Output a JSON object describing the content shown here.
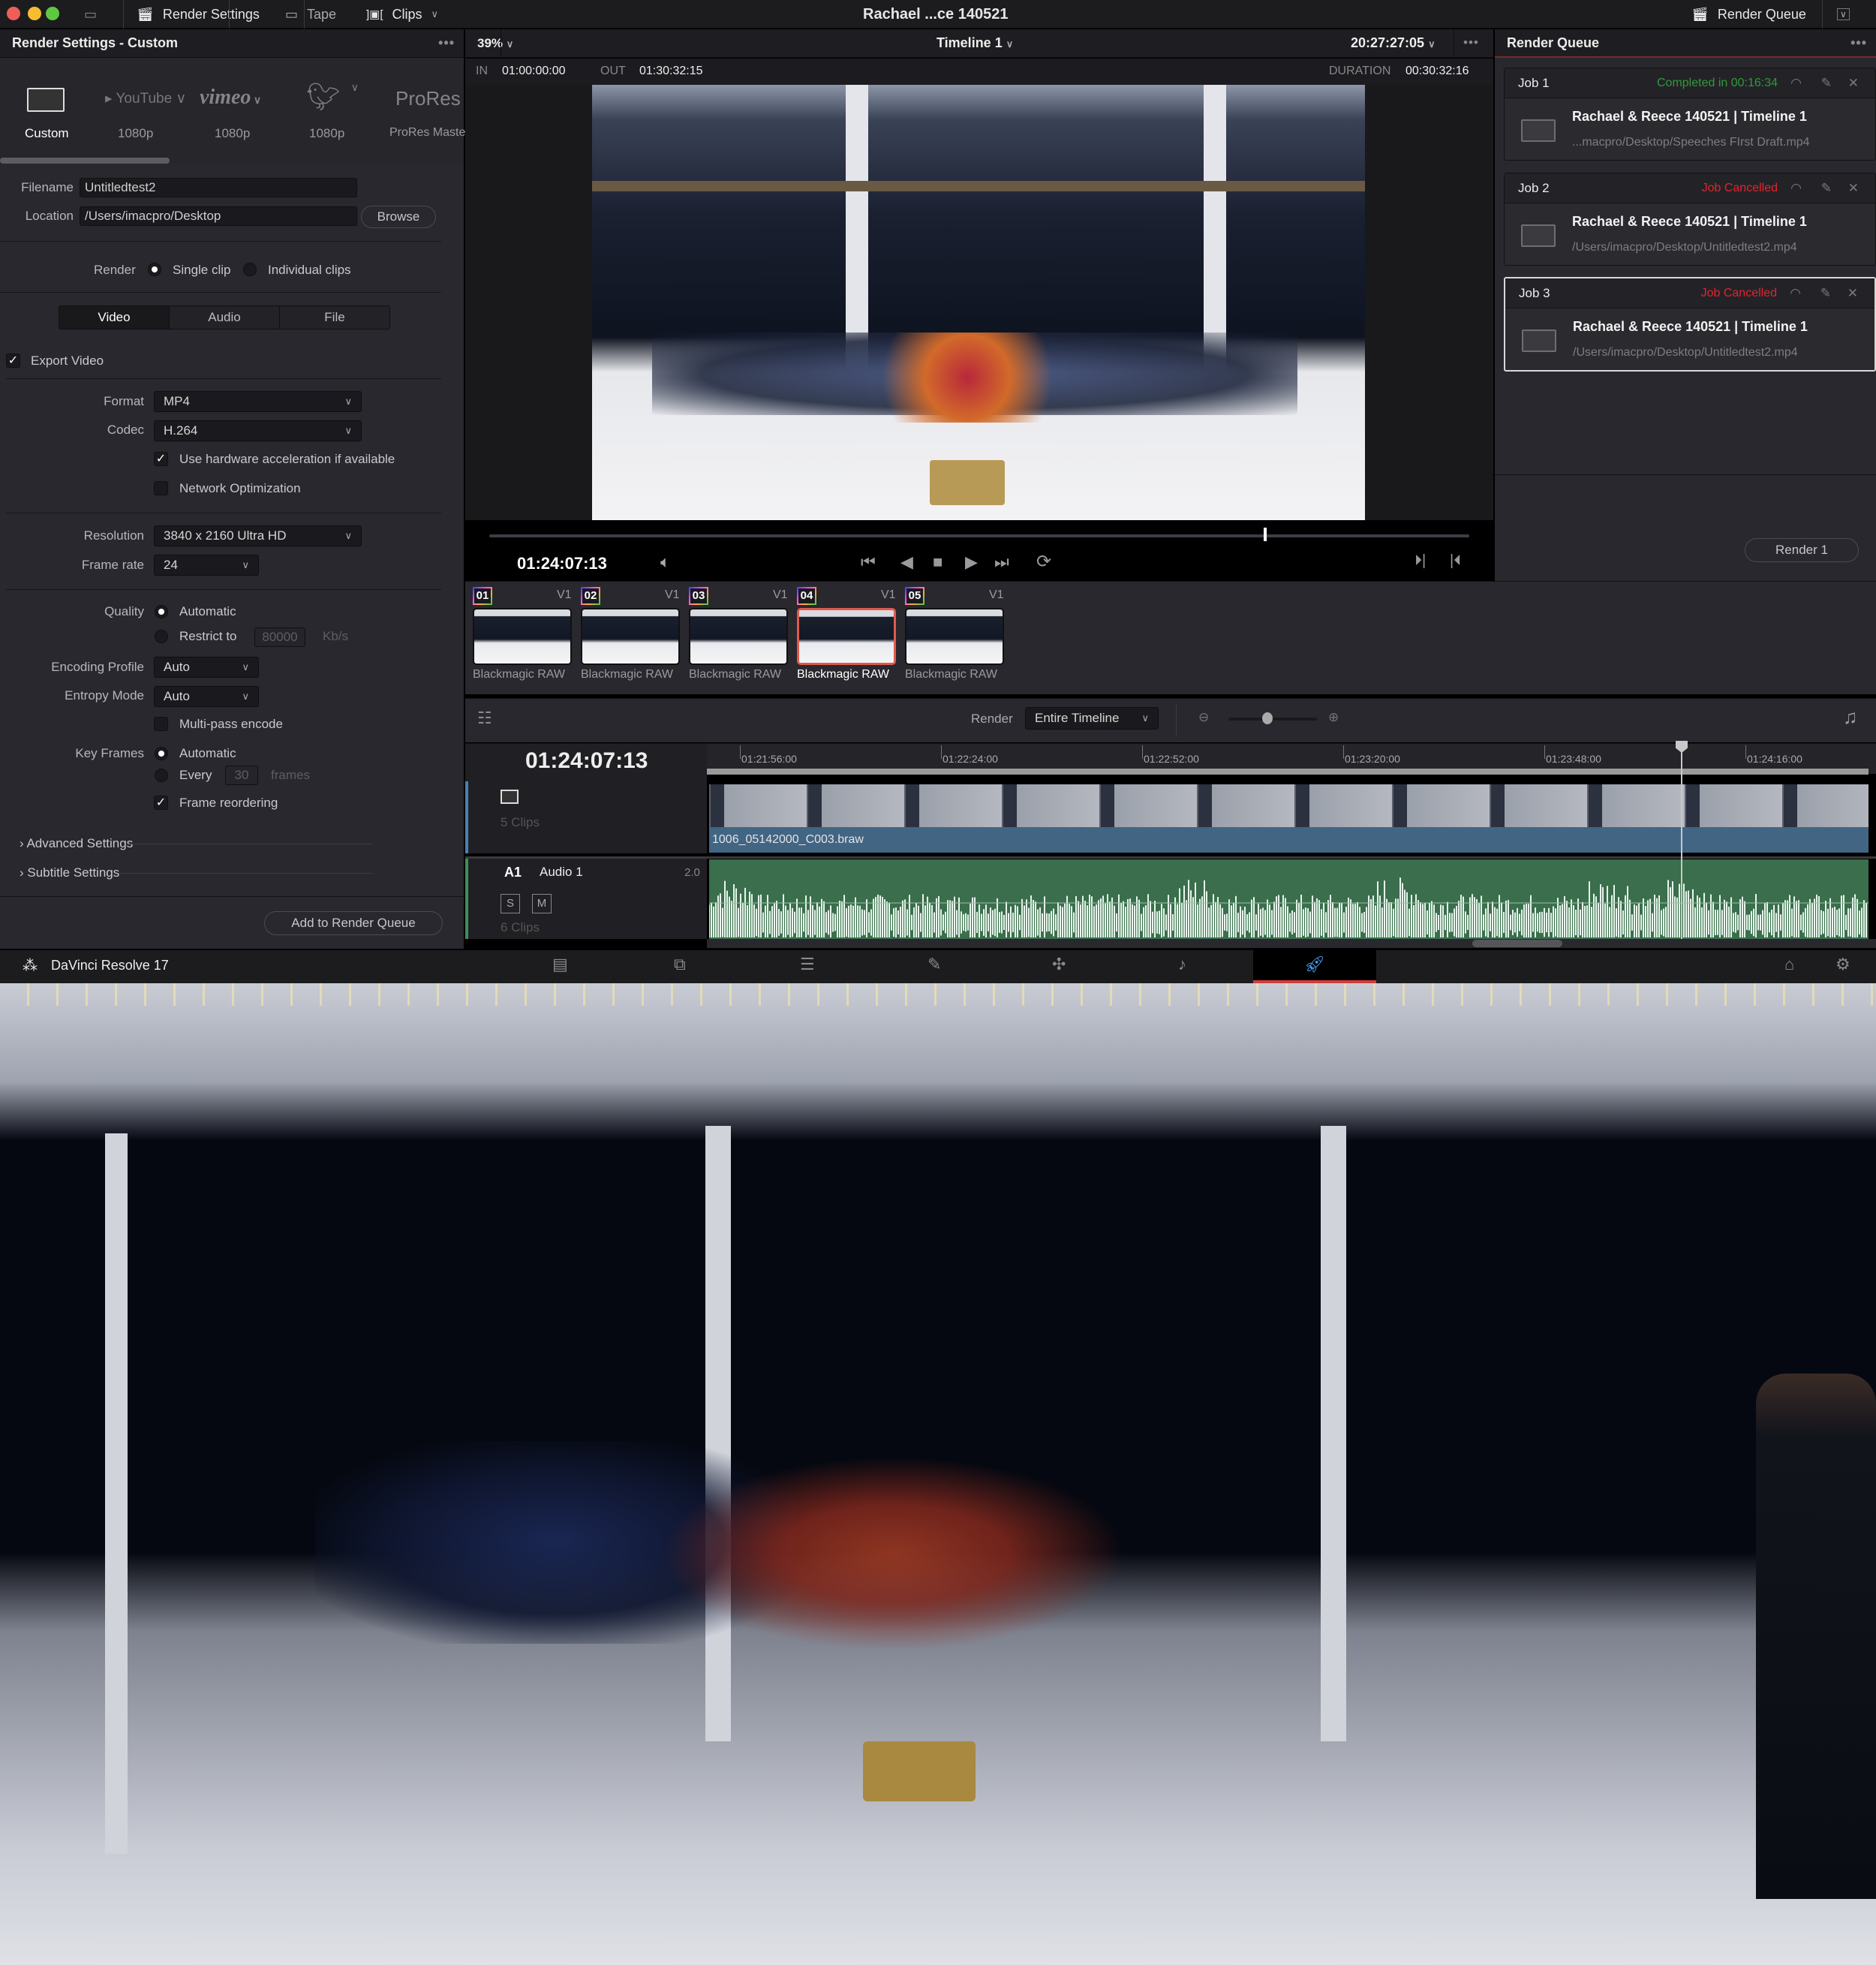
{
  "window": {
    "title": "Rachael ...ce 140521",
    "toolbar": {
      "render_settings": "Render Settings",
      "tape": "Tape",
      "clips": "Clips",
      "render_queue": "Render Queue"
    }
  },
  "render_settings": {
    "header": "Render Settings - Custom",
    "presets": [
      {
        "name": "Custom",
        "label": "Custom",
        "icon": "film-icon"
      },
      {
        "name": "YouTube",
        "label": "1080p",
        "icon": "youtube-logo"
      },
      {
        "name": "vimeo",
        "label": "1080p",
        "icon": "vimeo-logo"
      },
      {
        "name": "Twitter",
        "label": "1080p",
        "icon": "twitter-bird-icon"
      },
      {
        "name": "ProRes",
        "label": "ProRes Master",
        "icon": "prores-logo"
      }
    ],
    "filename_label": "Filename",
    "filename_value": "Untitledtest2",
    "location_label": "Location",
    "location_value": "/Users/imacpro/Desktop",
    "browse": "Browse",
    "render_label": "Render",
    "single_clip": "Single clip",
    "individual_clips": "Individual clips",
    "tabs": [
      "Video",
      "Audio",
      "File"
    ],
    "active_tab": "Video",
    "export_video": "Export Video",
    "format_label": "Format",
    "format_value": "MP4",
    "codec_label": "Codec",
    "codec_value": "H.264",
    "hw_accel": "Use hardware acceleration if available",
    "network_opt": "Network Optimization",
    "resolution_label": "Resolution",
    "resolution_value": "3840 x 2160 Ultra HD",
    "framerate_label": "Frame rate",
    "framerate_value": "24",
    "quality_label": "Quality",
    "quality_auto": "Automatic",
    "quality_restrict": "Restrict to",
    "quality_restrict_value": "80000",
    "quality_unit": "Kb/s",
    "encoding_profile_label": "Encoding Profile",
    "encoding_profile_value": "Auto",
    "entropy_label": "Entropy Mode",
    "entropy_value": "Auto",
    "multipass": "Multi-pass encode",
    "keyframes_label": "Key Frames",
    "keyframes_auto": "Automatic",
    "keyframes_every": "Every",
    "keyframes_every_value": "30",
    "keyframes_unit": "frames",
    "frame_reorder": "Frame reordering",
    "advanced": "Advanced Settings",
    "subtitle": "Subtitle Settings",
    "add_to_queue": "Add to Render Queue"
  },
  "viewer": {
    "zoom": "39%",
    "timeline_name": "Timeline 1",
    "timecode_top": "20:27:27:05",
    "in_label": "IN",
    "in_value": "01:00:00:00",
    "out_label": "OUT",
    "out_value": "01:30:32:15",
    "duration_label": "DURATION",
    "duration_value": "00:30:32:16",
    "current_tc": "01:24:07:13",
    "scrub_position": 0.79
  },
  "clips": [
    {
      "num": "01",
      "track": "V1",
      "name": "Blackmagic RAW"
    },
    {
      "num": "02",
      "track": "V1",
      "name": "Blackmagic RAW"
    },
    {
      "num": "03",
      "track": "V1",
      "name": "Blackmagic RAW"
    },
    {
      "num": "04",
      "track": "V1",
      "name": "Blackmagic RAW",
      "selected": true
    },
    {
      "num": "05",
      "track": "V1",
      "name": "Blackmagic RAW"
    }
  ],
  "timeline": {
    "render_label": "Render",
    "render_value": "Entire Timeline",
    "timecode": "01:24:07:13",
    "ruler": [
      "01:21:56:00",
      "01:22:24:00",
      "01:22:52:00",
      "01:23:20:00",
      "01:23:48:00",
      "01:24:16:00"
    ],
    "video_track_clips": "5 Clips",
    "video_clip_name": "1006_05142000_C003.braw",
    "audio_track_id": "A1",
    "audio_track_name": "Audio 1",
    "audio_channels": "2.0",
    "solo": "S",
    "mute": "M",
    "audio_track_clips": "6 Clips"
  },
  "render_queue": {
    "header": "Render Queue",
    "jobs": [
      {
        "id": "Job 1",
        "status": "Completed in 00:16:34",
        "status_color": "#2f9a3a",
        "title": "Rachael & Reece 140521 | Timeline 1",
        "path": "...macpro/Desktop/Speeches FIrst Draft.mp4"
      },
      {
        "id": "Job 2",
        "status": "Job Cancelled",
        "status_color": "#e0242f",
        "title": "Rachael & Reece 140521 | Timeline 1",
        "path": "/Users/imacpro/Desktop/Untitledtest2.mp4"
      },
      {
        "id": "Job 3",
        "status": "Job Cancelled",
        "status_color": "#e0242f",
        "title": "Rachael & Reece 140521 | Timeline 1",
        "path": "/Users/imacpro/Desktop/Untitledtest2.mp4",
        "selected": true
      }
    ],
    "render_button": "Render 1"
  },
  "footer": {
    "app_name": "DaVinci Resolve 17",
    "pages": [
      "media",
      "cut",
      "edit",
      "fusion",
      "color",
      "fairlight",
      "deliver"
    ],
    "active_page": "deliver"
  }
}
